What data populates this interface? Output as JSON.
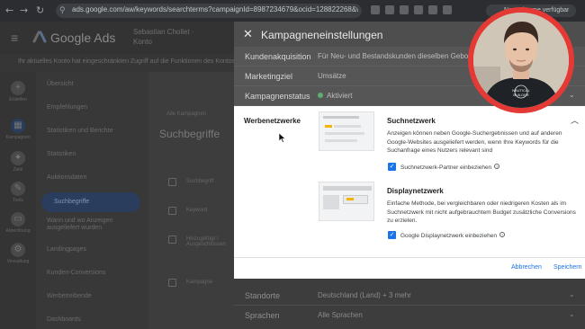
{
  "browser": {
    "url": "ads.google.com/aw/keywords/searchterms?campaignId=8987234679&ocid=128822268&workspaceId=...",
    "profile_label": "New Chrome verfügbar"
  },
  "app": {
    "logo": "Google Ads",
    "account": "Sebastian Chollet · Konto",
    "notice": "Ihr aktuelles Konto hat eingeschränkten Zugriff auf die Funktionen des Kontos",
    "rail_items": [
      {
        "label": "Erstellen"
      },
      {
        "label": "Kampagnen"
      },
      {
        "label": "Ziele"
      },
      {
        "label": "Tools"
      },
      {
        "label": "Abrechnung"
      },
      {
        "label": "Verwaltung"
      }
    ],
    "nav_items": [
      {
        "label": "Übersicht"
      },
      {
        "label": "Empfehlungen"
      },
      {
        "label": "Statistiken und Berichte"
      },
      {
        "label": "Statistiken"
      },
      {
        "label": "Auktionsdaten"
      },
      {
        "label": "Suchbegriffe"
      },
      {
        "label": "Wann und wo Anzeigen ausgeliefert wurden"
      },
      {
        "label": "Landingpages"
      },
      {
        "label": "Kunden-Conversions"
      },
      {
        "label": "Werbetreibende"
      },
      {
        "label": "Dashboards"
      }
    ],
    "main_title": "Suchbegriffe",
    "filter_chip": "Alle Kampagnen",
    "rows": [
      "Suchbegriff",
      "Keyword",
      "Hinzugefügt / Ausgeschlossen",
      "Kampagne"
    ]
  },
  "panel": {
    "title": "Kampagneneinstellungen",
    "rows_top": [
      {
        "key": "Kundenakquisition",
        "value": "Für Neu- und Bestandskunden dieselben Gebote"
      },
      {
        "key": "Marketingziel",
        "value": "Umsätze"
      },
      {
        "key": "Kampagnenstatus",
        "value": "Aktiviert"
      }
    ],
    "section_label": "Werbenetzwerke",
    "search_network": {
      "title": "Suchnetzwerk",
      "description": "Anzeigen können neben Google-Suchergebnissen und auf anderen Google-Websites ausgeliefert werden, wenn Ihre Keywords für die Suchanfrage eines Nutzers relevant sind",
      "checkbox_label": "Suchnetzwerk-Partner einbeziehen",
      "checked": true
    },
    "display_network": {
      "title": "Displaynetzwerk",
      "description": "Einfache Methode, bei vergleichbaren oder niedrigeren Kosten als im Suchnetzwerk mit nicht aufgebrauchtem Budget zusätzliche Conversions zu erzielen.",
      "checkbox_label": "Google Displaynetzwerk einbeziehen",
      "checked": true
    },
    "cancel_label": "Abbrechen",
    "save_label": "Speichern",
    "rows_bottom": [
      {
        "key": "Standorte",
        "value": "Deutschland (Land) + 3 mehr"
      },
      {
        "key": "Sprachen",
        "value": "Alle Sprachen"
      }
    ]
  },
  "webcam": {
    "badge_text": "NAUTICAL BUILDER"
  },
  "colors": {
    "accent": "#1a73e8",
    "status_active": "#5fae6f",
    "webcam_ring": "#e53935"
  }
}
